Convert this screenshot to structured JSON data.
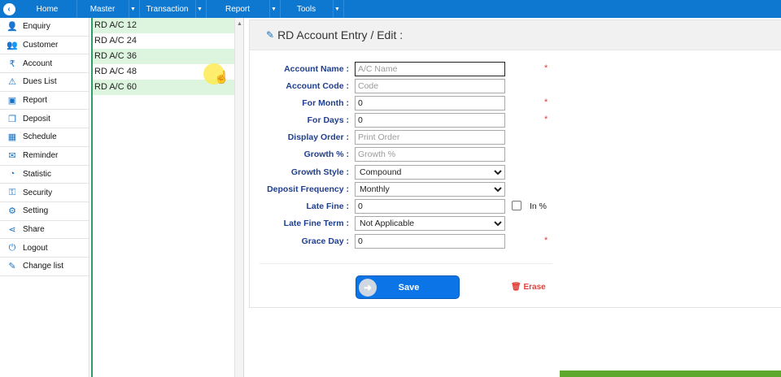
{
  "nav": {
    "back_icon": "arrow-left-circle-icon",
    "items": [
      {
        "label": "Home",
        "has_caret": false
      },
      {
        "label": "Master",
        "has_caret": true
      },
      {
        "label": "Transaction",
        "has_caret": true
      },
      {
        "label": "Report",
        "has_caret": true
      },
      {
        "label": "Tools",
        "has_caret": true
      }
    ],
    "caret_glyph": "▼"
  },
  "sidebar": {
    "items": [
      {
        "label": "Enquiry",
        "icon": "user-icon",
        "glyph": "👤"
      },
      {
        "label": "Customer",
        "icon": "user-plus-icon",
        "glyph": "👥"
      },
      {
        "label": "Account",
        "icon": "rupee-icon",
        "glyph": "₹"
      },
      {
        "label": "Dues List",
        "icon": "warning-icon",
        "glyph": "⚠"
      },
      {
        "label": "Report",
        "icon": "money-icon",
        "glyph": "▣"
      },
      {
        "label": "Deposit",
        "icon": "copy-icon",
        "glyph": "❐"
      },
      {
        "label": "Schedule",
        "icon": "calendar-icon",
        "glyph": "▦"
      },
      {
        "label": "Reminder",
        "icon": "envelope-icon",
        "glyph": "✉"
      },
      {
        "label": "Statistic",
        "icon": "pie-chart-icon",
        "glyph": "◔"
      },
      {
        "label": "Security",
        "icon": "key-icon",
        "glyph": "⚿"
      },
      {
        "label": "Setting",
        "icon": "gear-icon",
        "glyph": "⚙"
      },
      {
        "label": "Share",
        "icon": "share-icon",
        "glyph": "⋖"
      },
      {
        "label": "Logout",
        "icon": "power-icon",
        "glyph": "⏻"
      },
      {
        "label": "Change list",
        "icon": "edit-icon",
        "glyph": "✎"
      }
    ]
  },
  "account_list": [
    {
      "label": "RD A/C 12",
      "highlight": true
    },
    {
      "label": "RD A/C 24",
      "highlight": false
    },
    {
      "label": "RD A/C 36",
      "highlight": true
    },
    {
      "label": "RD A/C 48",
      "highlight": false
    },
    {
      "label": "RD A/C 60",
      "highlight": true
    }
  ],
  "form": {
    "title": "RD Account Entry / Edit :",
    "fields": [
      {
        "label": "Account Name :",
        "type": "text",
        "value": "",
        "placeholder": "A/C Name",
        "required": true
      },
      {
        "label": "Account Code :",
        "type": "text",
        "value": "",
        "placeholder": "Code",
        "required": false
      },
      {
        "label": "For Month :",
        "type": "text",
        "value": "0",
        "placeholder": "",
        "required": true
      },
      {
        "label": "For Days :",
        "type": "text",
        "value": "0",
        "placeholder": "",
        "required": true
      },
      {
        "label": "Display Order :",
        "type": "text",
        "value": "",
        "placeholder": "Print Order",
        "required": false
      },
      {
        "label": "Growth % :",
        "type": "text",
        "value": "",
        "placeholder": "Growth %",
        "required": false
      },
      {
        "label": "Growth Style :",
        "type": "select",
        "value": "Compound",
        "required": false
      },
      {
        "label": "Deposit Frequency :",
        "type": "select",
        "value": "Monthly",
        "required": false
      },
      {
        "label": "Late Fine :",
        "type": "text",
        "value": "0",
        "placeholder": "",
        "required": false,
        "checkbox_label": "In %"
      },
      {
        "label": "Late Fine Term :",
        "type": "select",
        "value": "Not Applicable",
        "required": false
      },
      {
        "label": "Grace Day :",
        "type": "text",
        "value": "0",
        "placeholder": "",
        "required": true
      }
    ],
    "required_mark": "*",
    "save_label": "Save",
    "erase_label": "Erase"
  },
  "colors": {
    "nav_bg": "#0e78d0",
    "label_color": "#1f3f8f",
    "list_highlight": "#ddf5df",
    "save_bg": "#0b74e6",
    "erase_color": "#e0403a",
    "required_color": "#e23b3b"
  }
}
